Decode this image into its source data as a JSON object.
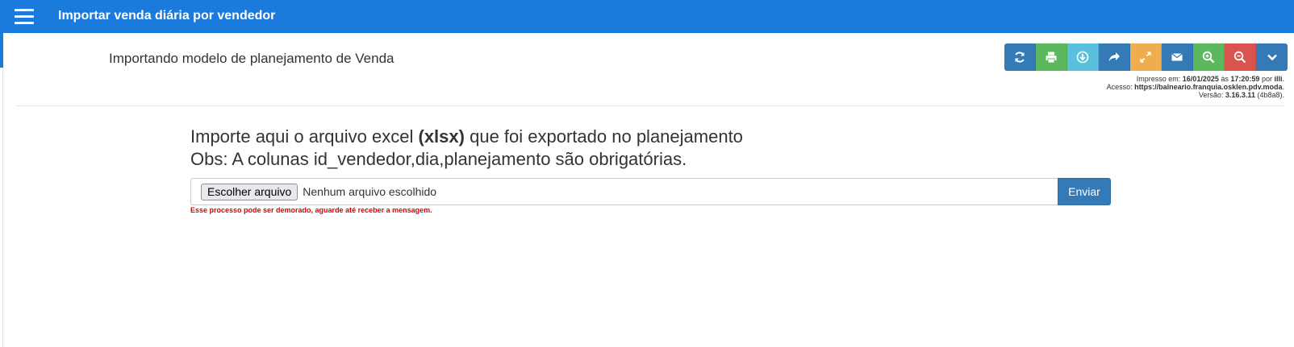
{
  "header": {
    "title": "Importar venda diária por vendedor",
    "menu_icon": "hamburger-menu-icon"
  },
  "page": {
    "heading": "Importando modelo de planejamento de Venda"
  },
  "toolbar": {
    "buttons": [
      {
        "name": "refresh",
        "icon": "refresh-icon",
        "color": "#337ab7"
      },
      {
        "name": "print",
        "icon": "print-icon",
        "color": "#5cb85c"
      },
      {
        "name": "download",
        "icon": "download-icon",
        "color": "#5bc0de"
      },
      {
        "name": "share",
        "icon": "share-icon",
        "color": "#337ab7"
      },
      {
        "name": "fullscreen",
        "icon": "fullscreen-icon",
        "color": "#f0ad4e"
      },
      {
        "name": "email",
        "icon": "email-icon",
        "color": "#337ab7"
      },
      {
        "name": "zoom-in",
        "icon": "zoom-in-icon",
        "color": "#5cb85c"
      },
      {
        "name": "zoom-out",
        "icon": "zoom-out-icon",
        "color": "#d9534f"
      },
      {
        "name": "more",
        "icon": "chevron-down-icon",
        "color": "#337ab7"
      }
    ]
  },
  "print_info": {
    "printed_label": "Impresso em:",
    "printed_date": "16/01/2025",
    "at_label": "às",
    "printed_time": "17:20:59",
    "by_label": "por",
    "user": "illi",
    "access_label": "Acesso:",
    "access_url": "https://balneario.franquia.osklen.pdv.moda",
    "version_label": "Versão:",
    "version": "3.16.3.11",
    "build": "(4b8a8)."
  },
  "instructions": {
    "line1_prefix": "Importe aqui o arquivo excel",
    "line1_bold": "(xlsx)",
    "line1_suffix": "que foi exportado no planejamento",
    "line2": "Obs: A colunas id_vendedor,dia,planejamento são obrigatórias."
  },
  "upload": {
    "choose_label": "Escolher arquivo",
    "status": "Nenhum arquivo escolhido",
    "submit_label": "Enviar",
    "warning": "Esse processo pode ser demorado, aguarde até receber a mensagem."
  },
  "colors": {
    "header_bg": "#1a7bdc",
    "primary": "#337ab7",
    "warning_text": "#e00000"
  }
}
